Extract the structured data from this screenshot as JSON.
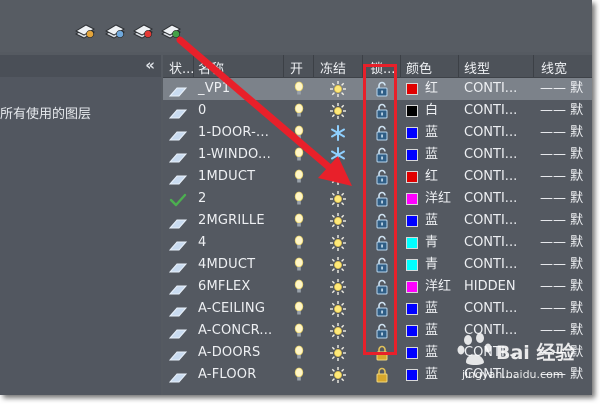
{
  "toolbar": {
    "buttons": [
      {
        "name": "new-layer-vp-frozen-icon",
        "accent": "#e3a43b"
      },
      {
        "name": "layer-states-icon",
        "accent": "#6fa8dc"
      },
      {
        "name": "delete-layer-icon",
        "accent": "#e53935"
      },
      {
        "name": "set-current-layer-icon",
        "accent": "#43a047"
      }
    ]
  },
  "left_panel": {
    "collapse_label": "«",
    "edge_text": "l",
    "filter_label": "所有使用的图层"
  },
  "table": {
    "columns": [
      "状...",
      "名称",
      "开",
      "冻结",
      "锁...",
      "颜色",
      "线型",
      "线宽"
    ],
    "rows": [
      {
        "status": "layer",
        "name": "_VP1",
        "on": true,
        "frozen": false,
        "locked": false,
        "color_hex": "#e00000",
        "color_name": "红",
        "linetype": "CONTI...",
        "lineweight": "—— 默",
        "selected": true
      },
      {
        "status": "layer",
        "name": "0",
        "on": true,
        "frozen": false,
        "locked": false,
        "color_hex": "#000000",
        "color_name": "白",
        "linetype": "CONTI...",
        "lineweight": "—— 默",
        "selected": false
      },
      {
        "status": "layer",
        "name": "1-DOOR-...",
        "on": true,
        "frozen": true,
        "locked": false,
        "color_hex": "#0000ff",
        "color_name": "蓝",
        "linetype": "CONTI...",
        "lineweight": "—— 默",
        "selected": false
      },
      {
        "status": "layer",
        "name": "1-WINDO...",
        "on": true,
        "frozen": true,
        "locked": false,
        "color_hex": "#0000ff",
        "color_name": "蓝",
        "linetype": "CONTI...",
        "lineweight": "—— 默",
        "selected": false
      },
      {
        "status": "layer",
        "name": "1MDUCT",
        "on": true,
        "frozen": false,
        "locked": false,
        "color_hex": "#e00000",
        "color_name": "红",
        "linetype": "CONTI...",
        "lineweight": "—— 默",
        "selected": false
      },
      {
        "status": "current",
        "name": "2",
        "on": true,
        "frozen": false,
        "locked": false,
        "color_hex": "#ff00ff",
        "color_name": "洋红",
        "linetype": "CONTI...",
        "lineweight": "—— 默",
        "selected": false
      },
      {
        "status": "layer",
        "name": "2MGRILLE",
        "on": true,
        "frozen": false,
        "locked": false,
        "color_hex": "#0000ff",
        "color_name": "蓝",
        "linetype": "CONTI...",
        "lineweight": "—— 默",
        "selected": false
      },
      {
        "status": "layer",
        "name": "4",
        "on": true,
        "frozen": false,
        "locked": false,
        "color_hex": "#00ffff",
        "color_name": "青",
        "linetype": "CONTI...",
        "lineweight": "—— 默",
        "selected": false
      },
      {
        "status": "layer",
        "name": "4MDUCT",
        "on": true,
        "frozen": false,
        "locked": false,
        "color_hex": "#00ffff",
        "color_name": "青",
        "linetype": "CONTI...",
        "lineweight": "—— 默",
        "selected": false
      },
      {
        "status": "layer",
        "name": "6MFLEX",
        "on": true,
        "frozen": false,
        "locked": false,
        "color_hex": "#ff00ff",
        "color_name": "洋红",
        "linetype": "HIDDEN",
        "lineweight": "—— 默",
        "selected": false
      },
      {
        "status": "layer",
        "name": "A-CEILING",
        "on": true,
        "frozen": false,
        "locked": false,
        "color_hex": "#0000ff",
        "color_name": "蓝",
        "linetype": "CONTI...",
        "lineweight": "—— 默",
        "selected": false
      },
      {
        "status": "layer",
        "name": "A-CONCR...",
        "on": true,
        "frozen": false,
        "locked": false,
        "color_hex": "#0000ff",
        "color_name": "蓝",
        "linetype": "CONTI...",
        "lineweight": "—— 默",
        "selected": false
      },
      {
        "status": "layer",
        "name": "A-DOORS",
        "on": true,
        "frozen": false,
        "locked": true,
        "color_hex": "#0000ff",
        "color_name": "蓝",
        "linetype": "CONTI...",
        "lineweight": "—— 默",
        "selected": false
      },
      {
        "status": "layer",
        "name": "A-FLOOR",
        "on": true,
        "frozen": false,
        "locked": true,
        "color_hex": "#0000ff",
        "color_name": "蓝",
        "linetype": "CONTI...",
        "lineweight": "—— 默",
        "selected": false
      }
    ]
  },
  "annotation": {
    "color": "#e8202a"
  },
  "watermark": {
    "text": "Bai 经验",
    "url": "jingyan.baidu.com"
  }
}
